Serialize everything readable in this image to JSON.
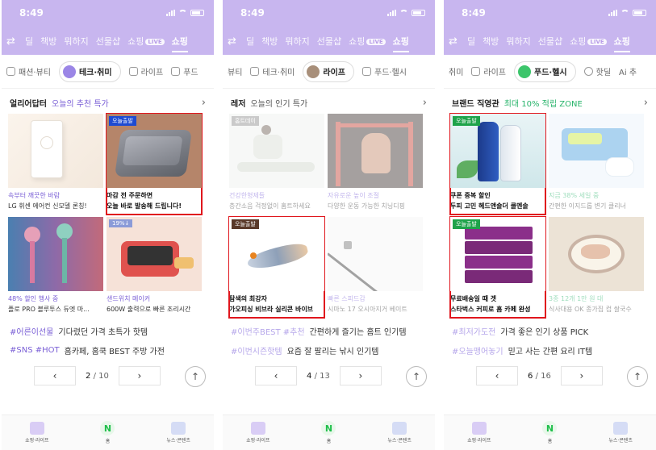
{
  "status": {
    "time": "8:49"
  },
  "topnav": {
    "items": [
      "딜",
      "책방",
      "뭐하지",
      "선물샵",
      "쇼핑",
      "쇼핑"
    ],
    "live_badge": "LIVE"
  },
  "bottom_nav": [
    "쇼핑·라이프",
    "홈",
    "뉴스·콘텐츠"
  ],
  "phones": [
    {
      "cats": [
        "패션·뷰티",
        "테크·취미",
        "라이프",
        "푸드"
      ],
      "head": {
        "title": "얼리어답터",
        "sub": "오늘의 추천 특가"
      },
      "cards": [
        {
          "badge": "",
          "cap1": "속부터 깨끗한 바람",
          "cap2": "LG 휘센 에어컨 신모델 론칭!"
        },
        {
          "badge": "오늘출발",
          "cap1": "마감 전 주문하면",
          "cap2": "오늘 바로 발송해 드립니다!"
        },
        {
          "badge": "",
          "cap1": "48% 할인 행사 중",
          "cap2": "플로 PRO 블루투스 듀엣 마..."
        },
        {
          "badge": "19%↓",
          "cap1": "샌드위치 메이커",
          "cap2": "600W 출력으로 빠른 조리시간"
        }
      ],
      "tags": [
        {
          "tags": "#어른이선물",
          "text": "기다렸던 가격 초특가 핫템"
        },
        {
          "tags": "#SNS #HOT",
          "text": "홈카페, 홈쿡 BEST 주방 가전"
        }
      ],
      "pager": {
        "current": "2",
        "sep": "/",
        "total": "10"
      }
    },
    {
      "cats": [
        "뷰티",
        "테크·취미",
        "라이프",
        "푸드·헬시"
      ],
      "head": {
        "title": "레저",
        "sub": "오늘의 인기 특가"
      },
      "cards": [
        {
          "badge": "홈트데이",
          "cap1": "건강한형제들",
          "cap2": "층간소음 걱정없이 홈트하세요"
        },
        {
          "badge": "",
          "cap1": "자유로운 높이 조절",
          "cap2": "다양한 운동 가능한 치닝디핑"
        },
        {
          "badge": "오늘출발",
          "cap1": "탐색의 최강자",
          "cap2": "가오피싱 비브라 실리콘 바이브"
        },
        {
          "badge": "",
          "cap1": "빠른 스피드감",
          "cap2": "시마노 17 오시아지거 베이트"
        }
      ],
      "tags": [
        {
          "tags": "#이번주BEST #추천",
          "text": "간편하게 즐기는 홈트 인기템"
        },
        {
          "tags": "#이번시즌핫템",
          "text": "요즘 잘 팔리는 낚시 인기템"
        }
      ],
      "pager": {
        "current": "4",
        "sep": "/",
        "total": "13"
      }
    },
    {
      "cats": [
        "취미",
        "라이프",
        "푸드·헬시",
        "핫딜",
        "Ai 추"
      ],
      "head": {
        "title": "브랜드 직영관",
        "sub": "최대 10% 적립 ZONE"
      },
      "cards": [
        {
          "badge": "오늘출발",
          "cap1": "쿠폰 중복 할인",
          "cap2": "두피 고민 헤드앤숄더 쿨멘솔"
        },
        {
          "badge": "",
          "cap1": "지금 38% 세일 중",
          "cap2": "간편한 이지드롭 변기 클리너"
        },
        {
          "badge": "오늘출발",
          "cap1": "무료배송일 때 겟",
          "cap2": "스타벅스 커피로 홈 카페 완성"
        },
        {
          "badge": "",
          "cap1": "3종 12개 1만 원 대",
          "cap2": "식사대용 OK 종가집 컵 쌀국수"
        }
      ],
      "tags": [
        {
          "tags": "#최저가도전",
          "text": "가격 좋은 인기 상품 PICK"
        },
        {
          "tags": "#오늘맹어놓기",
          "text": "믿고 사는 간편 요리 IT템"
        }
      ],
      "pager": {
        "current": "6",
        "sep": "/",
        "total": "16"
      }
    }
  ]
}
